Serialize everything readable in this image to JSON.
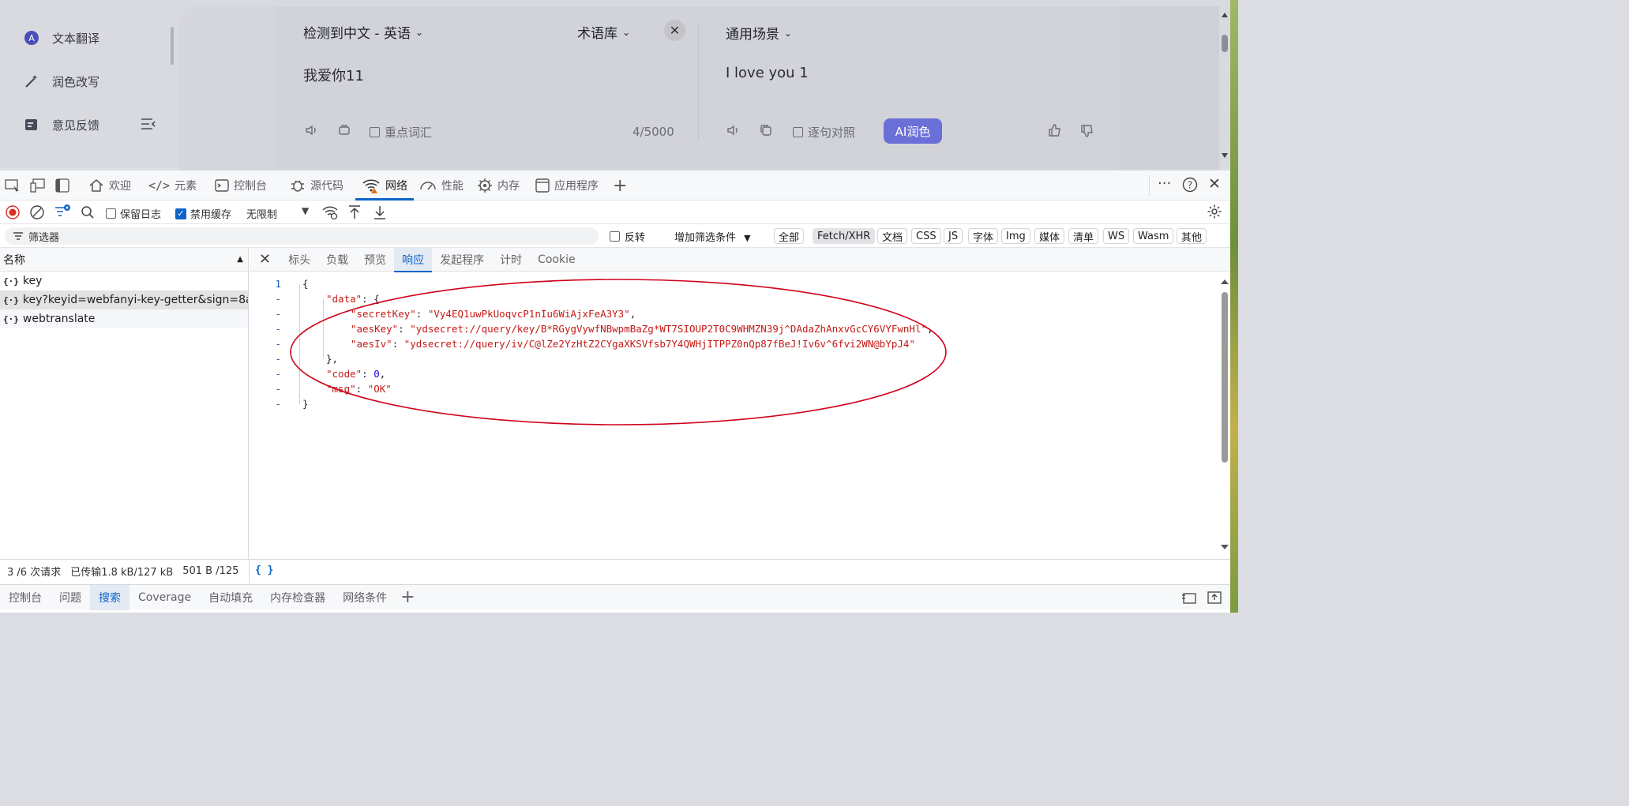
{
  "app": {
    "sidebar": [
      {
        "label": "文本翻译",
        "icon": "translate-icon"
      },
      {
        "label": "润色改写",
        "icon": "magic-wand-icon"
      },
      {
        "label": "意见反馈",
        "icon": "feedback-icon"
      }
    ],
    "source_lang": "检测到中文 - 英语",
    "glossary": "术语库",
    "scene": "通用场景",
    "source_text": "我爱你11",
    "target_text": "I love you 1",
    "key_words_label": "重点词汇",
    "char_count": "4/5000",
    "sentence_compare_label": "逐句对照",
    "ai_polish_label": "AI润色"
  },
  "devtools": {
    "tabs": [
      {
        "label": "欢迎",
        "icon": "home-icon"
      },
      {
        "label": "元素",
        "icon": "code-icon"
      },
      {
        "label": "控制台",
        "icon": "console-icon"
      },
      {
        "label": "源代码",
        "icon": "bug-icon"
      },
      {
        "label": "网络",
        "icon": "wifi-icon"
      },
      {
        "label": "性能",
        "icon": "gauge-icon"
      },
      {
        "label": "内存",
        "icon": "chip-icon"
      },
      {
        "label": "应用程序",
        "icon": "window-icon"
      }
    ],
    "toolbar": {
      "preserve_log": "保留日志",
      "disable_cache": "禁用缓存",
      "throttle": "无限制"
    },
    "filter": {
      "placeholder": "筛选器",
      "invert": "反转",
      "more_filters": "增加筛选条件",
      "chips": [
        "全部",
        "Fetch/XHR",
        "文档",
        "CSS",
        "JS",
        "字体",
        "Img",
        "媒体",
        "清单",
        "WS",
        "Wasm",
        "其他"
      ]
    },
    "requests": {
      "header": "名称",
      "rows": [
        {
          "icon": "{·}",
          "name": "key"
        },
        {
          "icon": "{·}",
          "name": "key?keyid=webfanyi-key-getter&sign=8a..."
        },
        {
          "icon": "{·}",
          "name": "webtranslate"
        }
      ]
    },
    "detail_tabs": [
      "标头",
      "负载",
      "预览",
      "响应",
      "发起程序",
      "计时",
      "Cookie"
    ],
    "response": {
      "line_numbers": [
        "1",
        "-",
        "-",
        "-",
        "-",
        "-",
        "-",
        "-",
        "-"
      ],
      "open_brace": "{",
      "data_key": "\"data\"",
      "secretKey_key": "\"secretKey\"",
      "secretKey_val": "\"Vy4EQ1uwPkUoqvcP1nIu6WiAjxFeA3Y3\"",
      "aesKey_key": "\"aesKey\"",
      "aesKey_val": "\"ydsecret://query/key/B*RGygVywfNBwpmBaZg*WT7SIOUP2T0C9WHMZN39j^DAdaZhAnxvGcCY6VYFwnHl\"",
      "aesIv_key": "\"aesIv\"",
      "aesIv_val": "\"ydsecret://query/iv/C@lZe2YzHtZ2CYgaXKSVfsb7Y4QWHjITPPZ0nQp87fBeJ!Iv6v^6fvi2WN@bYpJ4\"",
      "code_key": "\"code\"",
      "code_val": "0",
      "msg_key": "\"msg\"",
      "msg_val": "\"OK\""
    },
    "status": {
      "requests": "3 /6 次请求",
      "transferred": "已传输1.8 kB/127 kB",
      "resources": "501 B /125",
      "format": "{ }"
    },
    "drawer_tabs": [
      "控制台",
      "问题",
      "搜索",
      "Coverage",
      "自动填充",
      "内存检查器",
      "网络条件"
    ]
  },
  "colors": {
    "accent": "#0d64c8",
    "ai_button": "#6b6fd8",
    "json_string": "#c41a16",
    "json_number": "#1c00cf",
    "annotation": "#d0021b"
  }
}
